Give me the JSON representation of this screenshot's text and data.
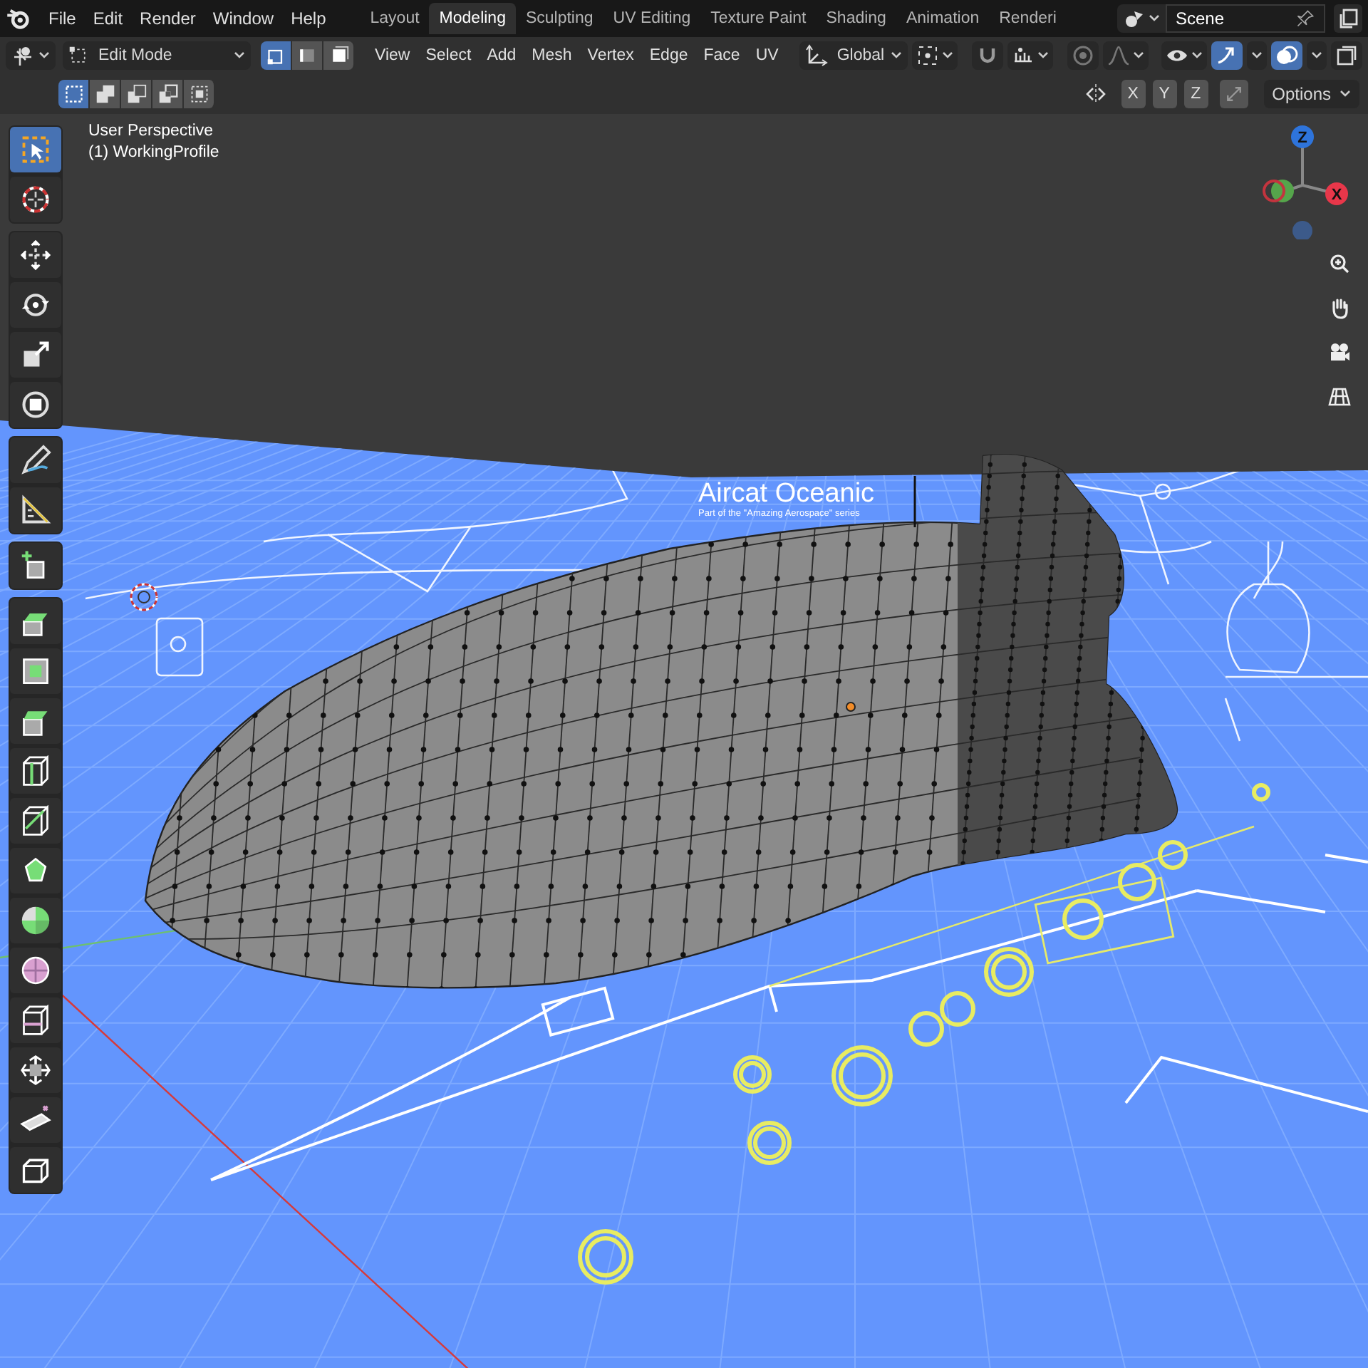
{
  "topbar": {
    "menus": [
      "File",
      "Edit",
      "Render",
      "Window",
      "Help"
    ],
    "workspaces": [
      {
        "label": "Layout",
        "selected": false
      },
      {
        "label": "Modeling",
        "selected": true
      },
      {
        "label": "Sculpting",
        "selected": false
      },
      {
        "label": "UV Editing",
        "selected": false
      },
      {
        "label": "Texture Paint",
        "selected": false
      },
      {
        "label": "Shading",
        "selected": false
      },
      {
        "label": "Animation",
        "selected": false
      },
      {
        "label": "Renderi",
        "selected": false
      }
    ],
    "scene": "Scene"
  },
  "header": {
    "mode": "Edit Mode",
    "select_modes": [
      {
        "kind": "vertex",
        "selected": true
      },
      {
        "kind": "edge",
        "selected": false
      },
      {
        "kind": "face",
        "selected": false
      }
    ],
    "menus": [
      "View",
      "Select",
      "Add",
      "Mesh",
      "Vertex",
      "Edge",
      "Face",
      "UV"
    ],
    "orientation": "Global"
  },
  "tool_settings": {
    "box_modes": [
      {
        "kind": "new",
        "selected": true
      },
      {
        "kind": "extend",
        "selected": false
      },
      {
        "kind": "subtract",
        "selected": false
      },
      {
        "kind": "invert",
        "selected": false
      },
      {
        "kind": "intersect",
        "selected": false
      }
    ],
    "axes": [
      "X",
      "Y",
      "Z"
    ],
    "options": "Options"
  },
  "viewport": {
    "overlay": [
      "User Perspective",
      "(1) WorkingProfile"
    ],
    "blueprint_title": "Aircat Oceanic",
    "blueprint_subtitle": "Part of the \"Amazing Aerospace\" series",
    "gizmo_axes": [
      {
        "label": "Z",
        "color": "#2e74db"
      },
      {
        "label": "X",
        "color": "#e8374a"
      }
    ]
  },
  "tool_groups": [
    {
      "tools": [
        {
          "kind": "select-box",
          "selected": true
        },
        {
          "kind": "cursor",
          "selected": false
        }
      ]
    },
    {
      "tools": [
        {
          "kind": "move",
          "selected": false
        },
        {
          "kind": "rotate",
          "selected": false
        },
        {
          "kind": "scale",
          "selected": false
        },
        {
          "kind": "transform",
          "selected": false
        }
      ]
    },
    {
      "tools": [
        {
          "kind": "annotate",
          "selected": false
        },
        {
          "kind": "measure",
          "selected": false
        }
      ]
    },
    {
      "tools": [
        {
          "kind": "add-cube",
          "selected": false
        }
      ]
    },
    {
      "tools": [
        {
          "kind": "extrude",
          "selected": false
        },
        {
          "kind": "inset",
          "selected": false
        },
        {
          "kind": "bevel",
          "selected": false
        },
        {
          "kind": "loop-cut",
          "selected": false
        },
        {
          "kind": "knife",
          "selected": false
        },
        {
          "kind": "poly-build",
          "selected": false
        },
        {
          "kind": "spin",
          "selected": false
        },
        {
          "kind": "smooth",
          "selected": false
        },
        {
          "kind": "edge-slide",
          "selected": false
        },
        {
          "kind": "shrink",
          "selected": false
        },
        {
          "kind": "shear",
          "selected": false
        },
        {
          "kind": "rip",
          "selected": false
        }
      ]
    }
  ]
}
